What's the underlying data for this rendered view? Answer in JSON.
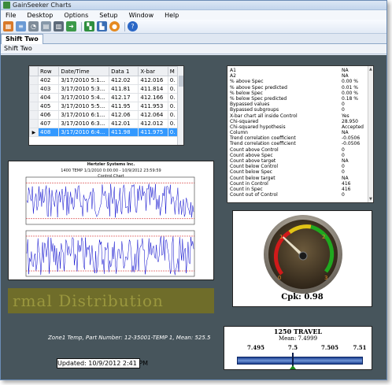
{
  "window": {
    "title": "GainSeeker Charts"
  },
  "menu": [
    "File",
    "Desktop",
    "Options",
    "Setup",
    "Window",
    "Help"
  ],
  "toolbar": {
    "icons": [
      "new-chart-icon",
      "data-icon",
      "gauge-icon",
      "print-preview-icon",
      "print-icon",
      "export-icon",
      "layout-icon",
      "filter-icon",
      "refresh-icon",
      "help-icon"
    ]
  },
  "tab": {
    "label": "Shift Two"
  },
  "subtab": {
    "label": "Shift Two"
  },
  "grid": {
    "columns": [
      "Row",
      "Date/Time",
      "Data 1",
      "X-bar",
      "M"
    ],
    "rows": [
      [
        "402",
        "3/17/2010 5:1...",
        "412.02",
        "412.016",
        "0."
      ],
      [
        "403",
        "3/17/2010 5:3...",
        "411.81",
        "411.814",
        "0."
      ],
      [
        "404",
        "3/17/2010 5:4...",
        "412.17",
        "412.166",
        "0."
      ],
      [
        "405",
        "3/17/2010 5:5...",
        "411.95",
        "411.953",
        "0."
      ],
      [
        "406",
        "3/17/2010 6:1...",
        "412.06",
        "412.064",
        "0."
      ],
      [
        "407",
        "3/17/2010 6:3...",
        "412.01",
        "412.012",
        "0."
      ],
      [
        "408",
        "3/17/2010 6:4...",
        "411.98",
        "411.975",
        "0."
      ]
    ],
    "selected_row": 6
  },
  "stats": [
    [
      "A1",
      "NA"
    ],
    [
      "A2",
      "NA"
    ],
    [
      "% above Spec",
      "0.00 %"
    ],
    [
      "% above Spec predicted",
      "0.01 %"
    ],
    [
      "% below Spec",
      "0.00 %"
    ],
    [
      "% below Spec predicted",
      "0.18 %"
    ],
    [
      "Bypassed values",
      "0"
    ],
    [
      "Bypassed subgroups",
      "0"
    ],
    [
      "X-bar chart all inside Control",
      "Yes"
    ],
    [
      "Chi-squared",
      "28.950"
    ],
    [
      "Chi-squared hypothesis",
      "Accepted"
    ],
    [
      "Column",
      "NA"
    ],
    [
      "Trend correlation coefficient",
      "-0.0506"
    ],
    [
      "Trend correlation coefficient",
      "-0.0506"
    ],
    [
      "Count above Control",
      "0"
    ],
    [
      "Count above Spec",
      "0"
    ],
    [
      "Count above target",
      "NA"
    ],
    [
      "Count below Control",
      "0"
    ],
    [
      "Count below Spec",
      "0"
    ],
    [
      "Count below target",
      "NA"
    ],
    [
      "Count in Control",
      "416"
    ],
    [
      "Count in Spec",
      "416"
    ],
    [
      "Count out of Control",
      "0"
    ]
  ],
  "control_chart": {
    "company": "Hertzler Systems Inc.",
    "subtitle": "1400 TEMP     1/1/2010 0:00:00 - 10/9/2012 23:59:59",
    "chart_title": "Control Chart"
  },
  "normal_distribution_banner": "rmal Distribution",
  "zone_text": "Zone1 Temp, Part Number: 12-35001-TEMP 1, Mean: 525.5",
  "updated": "Updated: 10/9/2012 2:41 PM",
  "gauge": {
    "scale_labels": [
      "0",
      "1",
      "2",
      "3"
    ],
    "cpk_label": "Cpk: 0.98",
    "cpk_value": 0.98
  },
  "travel": {
    "title": "1250 TRAVEL",
    "mean_label": "Mean: 7.4999",
    "ticks": [
      "7.495",
      "7.5",
      "7.505",
      "7.51"
    ],
    "mean_value": 7.4999
  },
  "colors": {
    "canvas": "#47555c",
    "selection": "#3399ff",
    "series": "#0000cc",
    "banner": "#6f6d2a"
  }
}
